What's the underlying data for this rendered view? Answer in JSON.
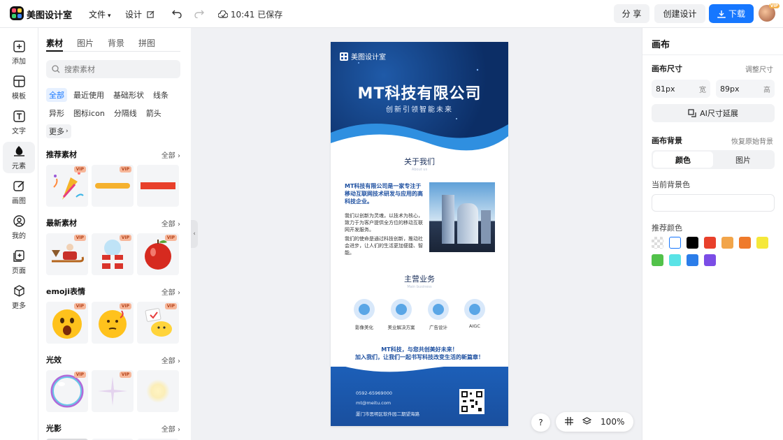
{
  "topbar": {
    "brand": "美图设计室",
    "file_menu": "文件",
    "design_menu": "设计",
    "save_status": "10:41 已保存",
    "share": "分 享",
    "create": "创建设计",
    "download": "下载",
    "avatar_badge": "VIP"
  },
  "rail": {
    "items": [
      {
        "label": "添加",
        "icon": "plus-square-icon"
      },
      {
        "label": "模板",
        "icon": "template-icon"
      },
      {
        "label": "文字",
        "icon": "text-icon"
      },
      {
        "label": "元素",
        "icon": "shapes-icon"
      },
      {
        "label": "画图",
        "icon": "pen-icon"
      },
      {
        "label": "我的",
        "icon": "user-icon"
      },
      {
        "label": "页面",
        "icon": "page-add-icon"
      },
      {
        "label": "更多",
        "icon": "cube-icon"
      }
    ],
    "active": "元素"
  },
  "panel": {
    "tabs": [
      "素材",
      "图片",
      "背景",
      "拼图"
    ],
    "search_placeholder": "搜索素材",
    "chips": [
      "全部",
      "最近使用",
      "基础形状",
      "线条",
      "异形",
      "图标icon",
      "分隔线",
      "箭头",
      "更多"
    ],
    "vip_badge": "VIP",
    "sections": [
      {
        "title": "推荐素材",
        "all": "全部"
      },
      {
        "title": "最新素材",
        "all": "全部"
      },
      {
        "title": "emoji表情",
        "all": "全部"
      },
      {
        "title": "光效",
        "all": "全部"
      },
      {
        "title": "光影",
        "all": "全部"
      }
    ]
  },
  "poster": {
    "brand": "美图设计室",
    "title": "MT科技有限公司",
    "subtitle": "创新引领智能未来",
    "about_title": "关于我们",
    "about_sub": "About us",
    "about_lead": "MT科技有限公司是一家专注于移动互联网技术研发与应用的高科技企业。",
    "about_p1": "我们以创新为灵魂，以技术为核心，致力于为客户提供全方位的移动互联网开发服务。",
    "about_p2": "我们的使命是通过科技创新，推动社会进步，让人们的生活更加便捷、智能。",
    "biz_title": "主营业务",
    "biz_sub": "Main business",
    "services": [
      "影像美化",
      "美业解决方案",
      "广告设计",
      "AIGC"
    ],
    "slogan1": "MT科技，与您共创美好未来！",
    "slogan2": "加入我们，让我们一起书写科技改变生活的新篇章！",
    "contact_phone": "0592-65969000",
    "contact_email": "mt@meitu.com",
    "contact_addr": "厦门市思明区软件园二期望海路"
  },
  "tools": {
    "help": "?",
    "zoom": "100%"
  },
  "right": {
    "title": "画布",
    "size_label": "画布尺寸",
    "size_link": "调整尺寸",
    "width_value": "81px",
    "width_unit": "宽",
    "height_value": "89px",
    "height_unit": "高",
    "ai_extend": "AI尺寸延展",
    "bg_label": "画布背景",
    "bg_reset": "恢复原始背景",
    "seg_color": "颜色",
    "seg_image": "图片",
    "current_label": "当前背景色",
    "recommend_label": "推荐颜色",
    "colors": [
      "transparent",
      "#ffffff",
      "#000000",
      "#e8402b",
      "#f2a54a",
      "#ef7a2b",
      "#f5e83a",
      "#52c24a",
      "#5ae3e6",
      "#2b7de9",
      "#7b4de6"
    ]
  }
}
